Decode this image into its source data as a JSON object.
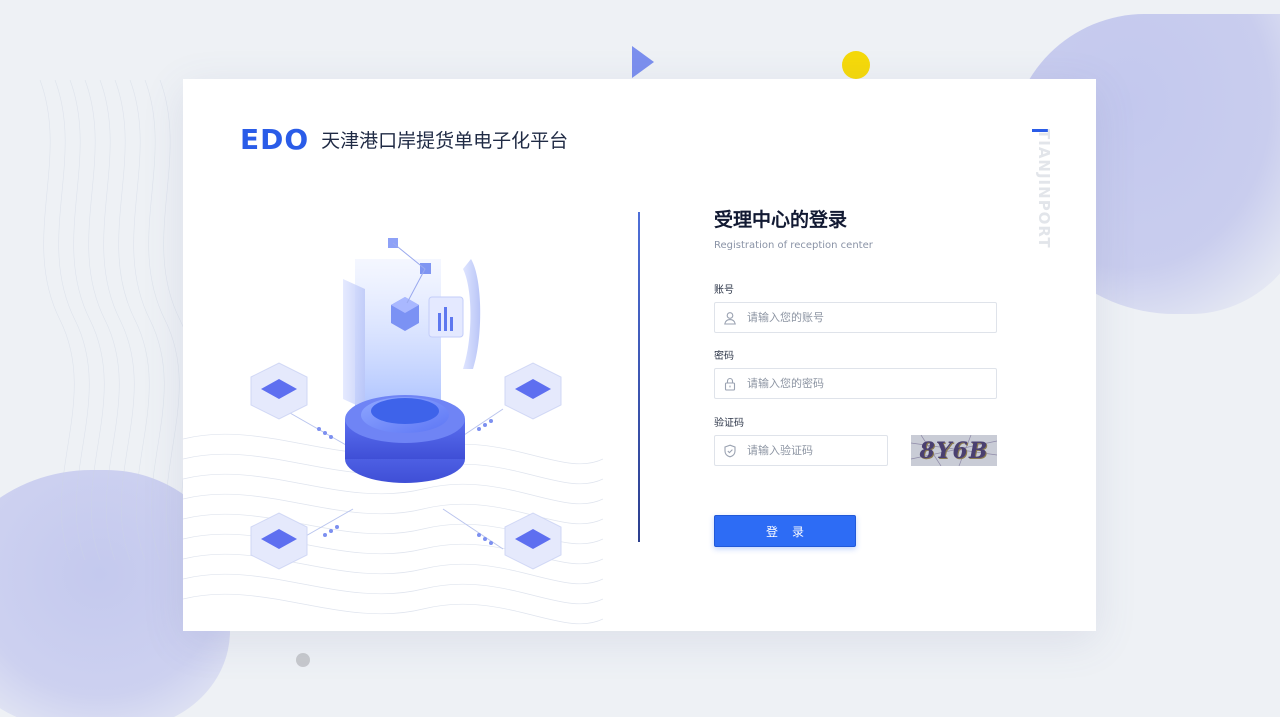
{
  "brand": {
    "logo": "EDO",
    "title": "天津港口岸提货单电子化平台"
  },
  "side_text": "TIANJINPORT",
  "form": {
    "title": "受理中心的登录",
    "subtitle": "Registration of reception center",
    "account": {
      "label": "账号",
      "placeholder": "请输入您的账号",
      "icon": "user-icon"
    },
    "password": {
      "label": "密码",
      "placeholder": "请输入您的密码",
      "icon": "lock-icon"
    },
    "captcha": {
      "label": "验证码",
      "placeholder": "请输入验证码",
      "icon": "shield-icon",
      "image_text": "8Y6B"
    },
    "submit_label": "登录"
  },
  "colors": {
    "accent": "#2d6cf5",
    "brand": "#2a5ce8",
    "deco_yellow": "#f5d90a",
    "deco_triangle": "#7b8fee"
  }
}
